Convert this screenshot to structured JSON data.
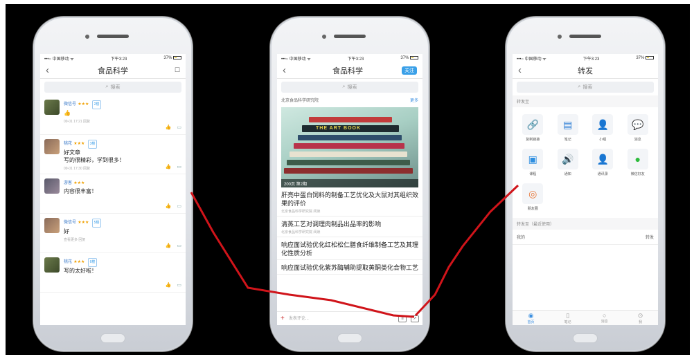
{
  "phone1": {
    "status": {
      "carrier": "•••○ 中国移动 ᯤ",
      "time": "下午3:23",
      "battery": "37%"
    },
    "nav": {
      "back": "‹",
      "title": "食品科学"
    },
    "search_placeholder": "搜索",
    "comments": [
      {
        "name": "微信号",
        "badge": "2楼",
        "text": "👍",
        "meta": "09-01 17:21  回复"
      },
      {
        "name": "桃花",
        "badge": "3楼",
        "text": "好文章\n写的很精彩，学到很多！",
        "meta": "09-01 17:30  回复"
      },
      {
        "name": "游客",
        "badge": "",
        "text": "内容很丰富！",
        "meta": ""
      },
      {
        "name": "微信号",
        "badge": "5楼",
        "text": "好",
        "meta": "查看更多  回复"
      },
      {
        "name": "桃花",
        "badge": "6楼",
        "text": "写的太好啦！",
        "meta": ""
      }
    ]
  },
  "phone2": {
    "status": {
      "carrier": "•••○ 中国移动 ᯤ",
      "time": "下午3:23",
      "battery": "37%"
    },
    "nav": {
      "back": "‹",
      "title": "食品科学",
      "follow": "关注"
    },
    "search_placeholder": "搜索",
    "recommend": {
      "label": "北京食品科学研究院",
      "more": "更多"
    },
    "hero": {
      "book_text": "THE ART BOOK",
      "caption": "200页 第2期"
    },
    "articles": [
      {
        "title": "肝亮中蛋白饲料的制备工艺优化及大鼠对其组织效果的评价",
        "meta": "北京食品科学研究院  阅读"
      },
      {
        "title": "清蒸工艺对调理肉制品出品率的影响",
        "meta": "北京食品科学研究院  阅读"
      },
      {
        "title": "响应面试验优化红松松仁膳食纤维制备工艺及其理化性质分析",
        "meta": ""
      },
      {
        "title": "响应面试验优化紫苏酶辅助提取黄酮类化合物工艺",
        "meta": ""
      }
    ],
    "bottombar": {
      "input_placeholder": "发表评论...",
      "add": "+"
    }
  },
  "phone3": {
    "status": {
      "carrier": "•••○ 中国移动 ᯤ",
      "time": "下午3:23",
      "battery": "37%"
    },
    "nav": {
      "back": "‹",
      "title": "转发"
    },
    "search_placeholder": "搜索",
    "section1": "转发至",
    "share_items": [
      {
        "icon": "link-icon",
        "glyph": "🔗",
        "label": "复制链接",
        "color": "#3b8fe0"
      },
      {
        "icon": "note-icon",
        "glyph": "▤",
        "label": "笔记",
        "color": "#2f7fd6"
      },
      {
        "icon": "person-icon",
        "glyph": "👤",
        "label": "小组",
        "color": "#2f7fd6"
      },
      {
        "icon": "chat-icon",
        "glyph": "💬",
        "label": "消息",
        "color": "#1fa3e8"
      },
      {
        "icon": "screen-icon",
        "glyph": "▣",
        "label": "课程",
        "color": "#2f8fe0"
      },
      {
        "icon": "speaker-icon",
        "glyph": "🔊",
        "label": "通知",
        "color": "#2f7fd6"
      },
      {
        "icon": "contact-icon",
        "glyph": "👤",
        "label": "通讯录",
        "color": "#2f7fd6"
      },
      {
        "icon": "wechat-icon",
        "glyph": "●",
        "label": "微信好友",
        "color": "#2dbb3c"
      },
      {
        "icon": "moments-icon",
        "glyph": "◎",
        "label": "朋友圈",
        "color": "#e8793b"
      }
    ],
    "section2": "转发至（最近使用）",
    "recent": {
      "left": "我的",
      "right": "转发"
    },
    "tabs": [
      {
        "icon": "compass-icon",
        "glyph": "◉",
        "label": "首页"
      },
      {
        "icon": "doc-icon",
        "glyph": "▯",
        "label": "笔记"
      },
      {
        "icon": "chat-bubble-icon",
        "glyph": "○",
        "label": "消息"
      },
      {
        "icon": "me-icon",
        "glyph": "⊙",
        "label": "我"
      }
    ]
  },
  "annotation_color": "#d0141a"
}
